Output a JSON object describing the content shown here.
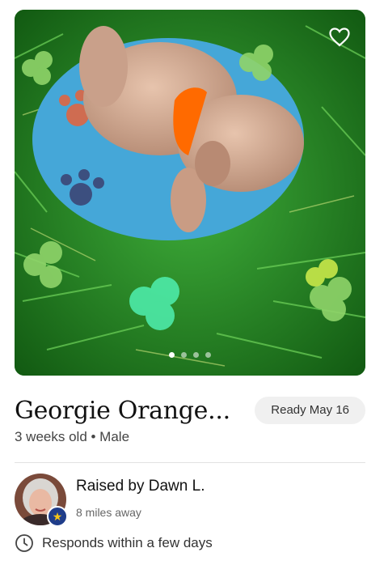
{
  "listing": {
    "name": "Georgie Orange...",
    "ready_label": "Ready May 16",
    "subtitle": "3 weeks old • Male",
    "photo": {
      "total_photos": 4,
      "active_photo_index": 0
    },
    "favorite_icon": "heart-outline-icon"
  },
  "breeder": {
    "raised_by": "Raised by Dawn L.",
    "distance": "8 miles away",
    "badge_icon": "star-icon"
  },
  "response": {
    "icon": "clock-icon",
    "text": "Responds within a few days"
  },
  "colors": {
    "badge_bg": "#f0f0f0",
    "star_badge": "#1f3d8a",
    "star": "#f5c518",
    "collar": "#ff6a00"
  }
}
